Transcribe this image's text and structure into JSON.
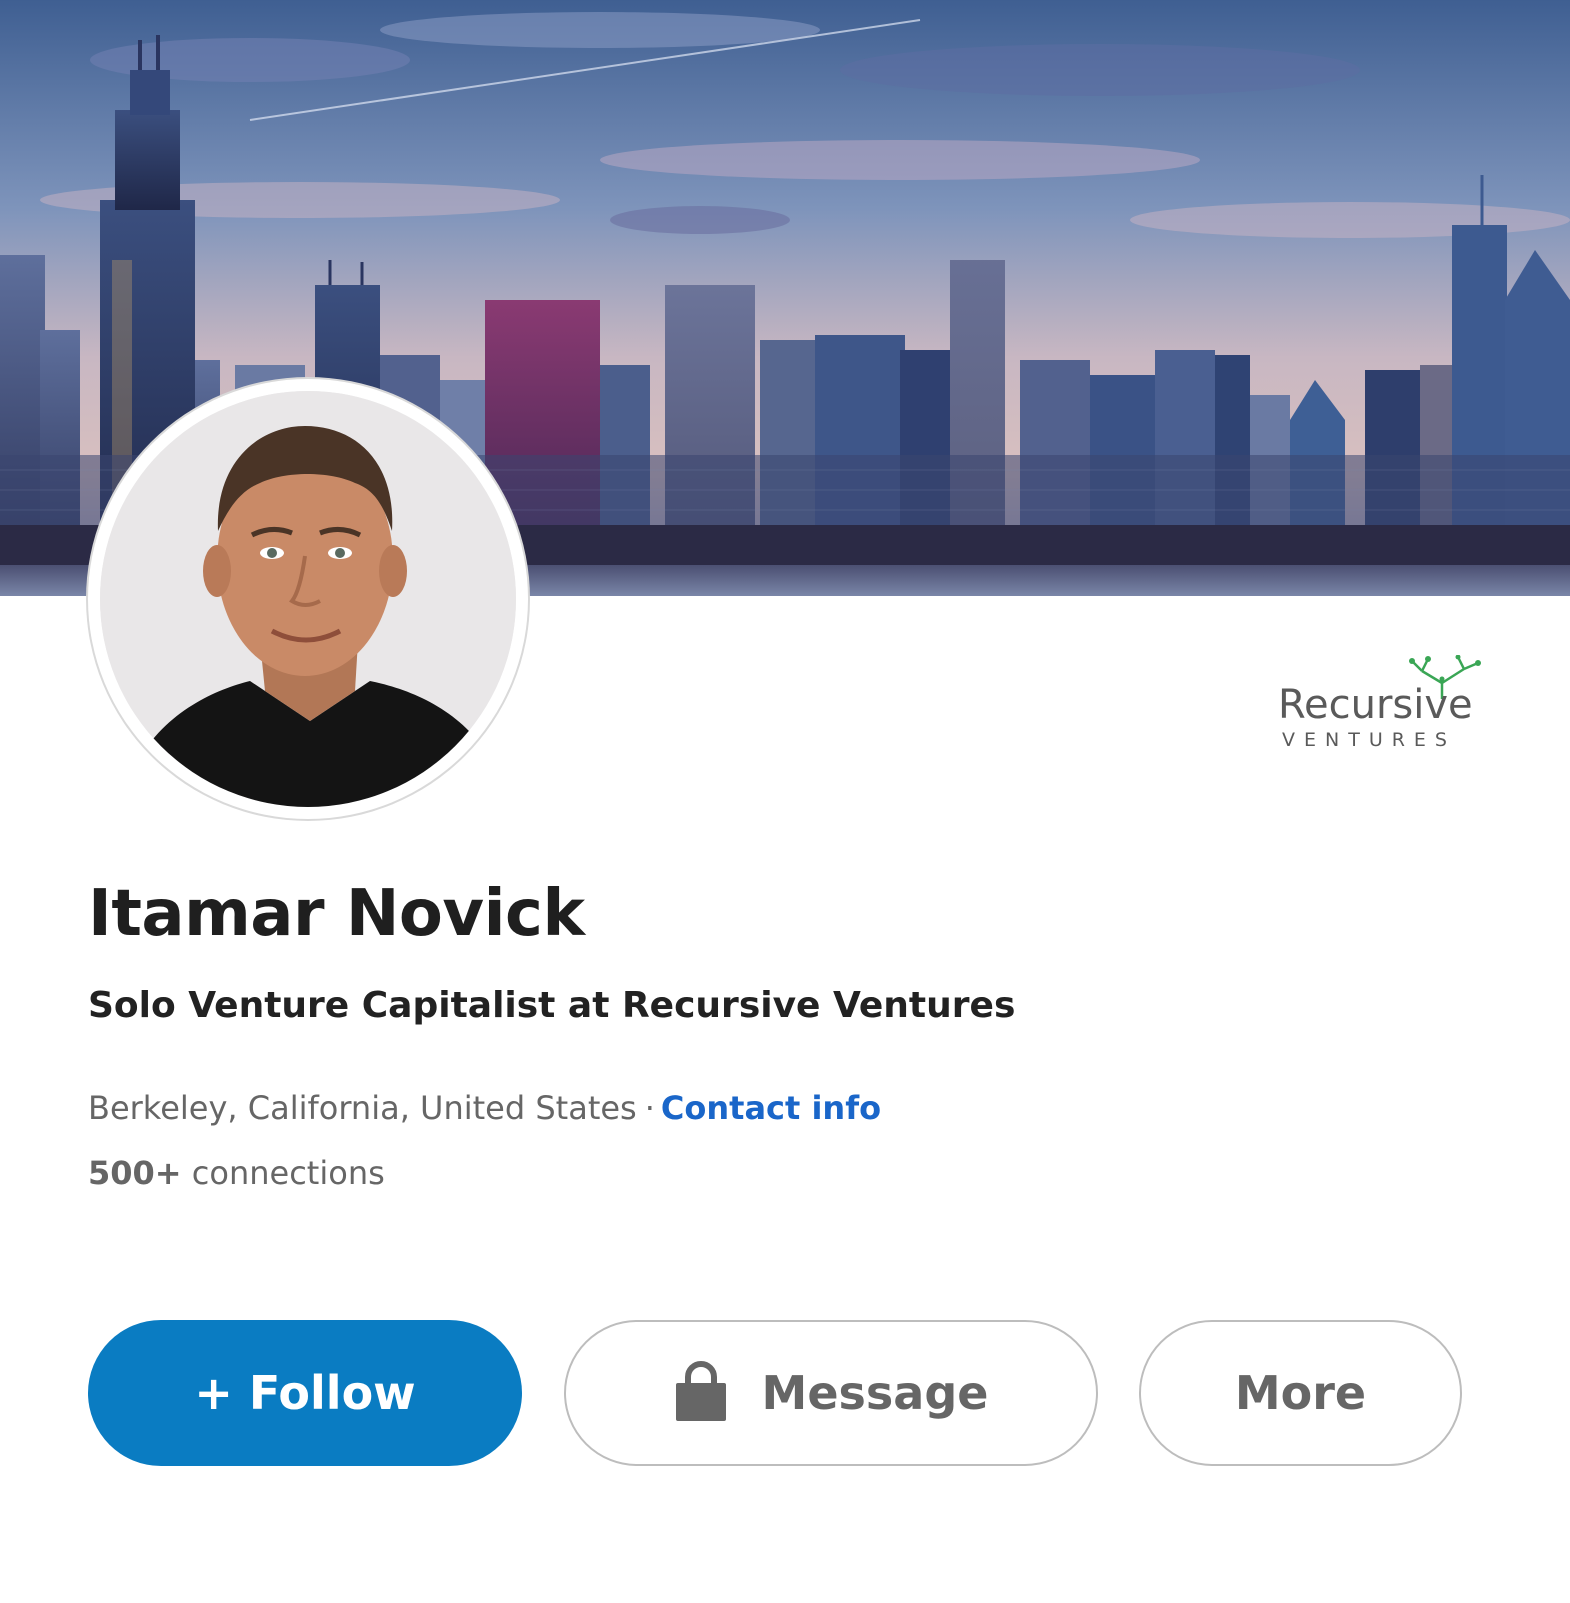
{
  "profile": {
    "name": "Itamar Novick",
    "headline": "Solo Venture Capitalist at Recursive Ventures",
    "location": "Berkeley, California, United States",
    "separator": "·",
    "contact_link": "Contact info",
    "connections_count": "500+",
    "connections_label": "connections"
  },
  "company_logo": {
    "line1": "Recursive",
    "line2": "VENTURES",
    "accent": "#3aa655"
  },
  "actions": {
    "follow_label": "+ Follow",
    "message_label": "Message",
    "more_label": "More"
  },
  "icons": {
    "message_icon": "lock-icon"
  },
  "colors": {
    "follow_bg": "#0a7cc2",
    "link": "#1a66c9",
    "muted_text": "#666666"
  }
}
